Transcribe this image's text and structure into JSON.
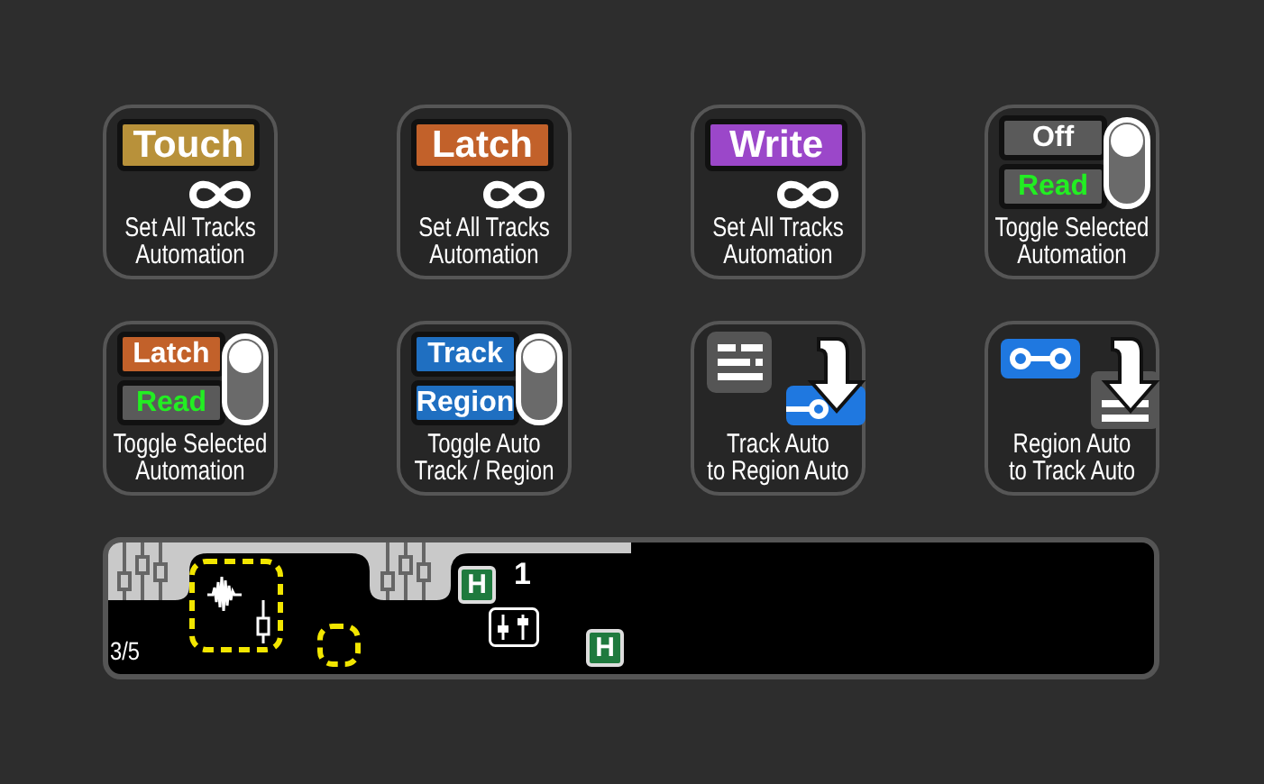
{
  "buttons": [
    {
      "kind": "mode",
      "badges": [
        {
          "label": "Touch",
          "color": "#b8913a",
          "kind": "plain"
        }
      ],
      "caption": [
        "Set All Tracks",
        "Automation"
      ]
    },
    {
      "kind": "mode",
      "badges": [
        {
          "label": "Latch",
          "color": "#c2612a",
          "kind": "plain"
        }
      ],
      "caption": [
        "Set All Tracks",
        "Automation"
      ]
    },
    {
      "kind": "mode",
      "badges": [
        {
          "label": "Write",
          "color": "#9b47c9",
          "kind": "plain"
        }
      ],
      "caption": [
        "Set All Tracks",
        "Automation"
      ]
    },
    {
      "kind": "toggle",
      "badges": [
        {
          "label": "Off",
          "color": "#5a5a5a",
          "kind": "plain"
        },
        {
          "label": "Read",
          "color": "#5a5a5a",
          "kind": "read"
        }
      ],
      "caption": [
        "Toggle Selected",
        "Automation"
      ]
    },
    {
      "kind": "toggle",
      "badges": [
        {
          "label": "Latch",
          "color": "#c2612a",
          "kind": "plain"
        },
        {
          "label": "Read",
          "color": "#5a5a5a",
          "kind": "read"
        }
      ],
      "caption": [
        "Toggle Selected",
        "Automation"
      ]
    },
    {
      "kind": "toggle",
      "badges": [
        {
          "label": "Track",
          "color": "#1f6fc1",
          "kind": "plain"
        },
        {
          "label": "Region",
          "color": "#1f6fc1",
          "kind": "plain"
        }
      ],
      "caption": [
        "Toggle Auto",
        "Track / Region"
      ]
    },
    {
      "kind": "track-to-region",
      "caption": [
        "Track Auto",
        "to Region Auto"
      ]
    },
    {
      "kind": "region-to-track",
      "caption": [
        "Region Auto",
        "to Track Auto"
      ]
    }
  ],
  "display": {
    "page": "3/5",
    "channel": "1",
    "markers": [
      "H",
      "H"
    ]
  }
}
